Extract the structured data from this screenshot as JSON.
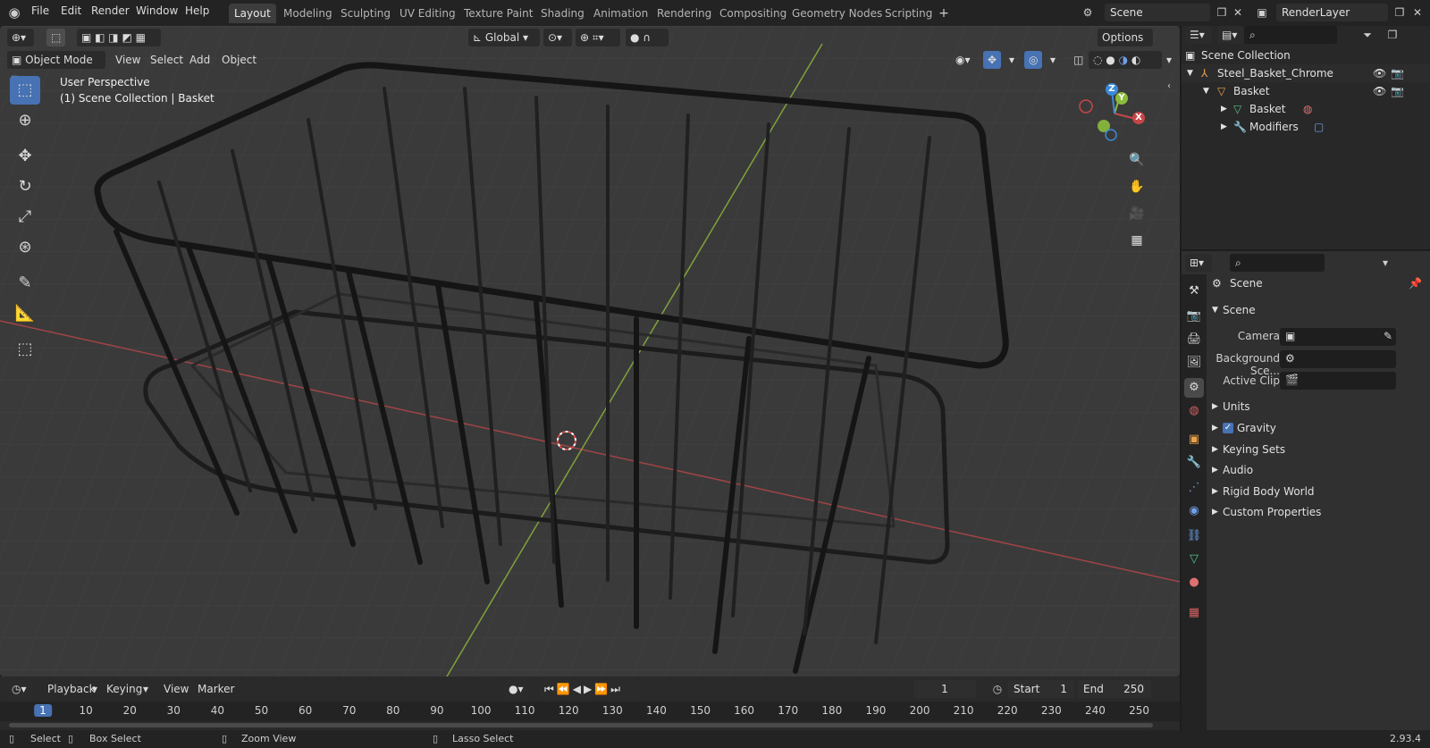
{
  "menu": [
    "File",
    "Edit",
    "Render",
    "Window",
    "Help"
  ],
  "workspaces": [
    "Layout",
    "Modeling",
    "Sculpting",
    "UV Editing",
    "Texture Paint",
    "Shading",
    "Animation",
    "Rendering",
    "Compositing",
    "Geometry Nodes",
    "Scripting"
  ],
  "scene_field": "Scene",
  "renderlayer_field": "RenderLayer",
  "viewport": {
    "transform_orientation": "Global",
    "options_label": "Options",
    "mode": "Object Mode",
    "header_menus": [
      "View",
      "Select",
      "Add",
      "Object"
    ],
    "overlay_line1": "User Perspective",
    "overlay_line2": "(1) Scene Collection | Basket",
    "gizmo": {
      "x": "X",
      "y": "Y",
      "z": "Z"
    }
  },
  "outliner": {
    "root": "Scene Collection",
    "items": [
      {
        "label": "Steel_Basket_Chrome"
      },
      {
        "label": "Basket"
      },
      {
        "label": "Basket"
      },
      {
        "label": "Modifiers"
      }
    ]
  },
  "properties": {
    "header": "Scene",
    "panel_title": "Scene",
    "fields": [
      {
        "label": "Camera"
      },
      {
        "label": "Background Sce..."
      },
      {
        "label": "Active Clip"
      }
    ],
    "subpanels": [
      "Units",
      "Gravity",
      "Keying Sets",
      "Audio",
      "Rigid Body World",
      "Custom Properties"
    ]
  },
  "timeline": {
    "menus": [
      "Playback",
      "Keying",
      "View",
      "Marker"
    ],
    "current_frame": "1",
    "start_label": "Start",
    "start_value": "1",
    "end_label": "End",
    "end_value": "250",
    "ruler": [
      "1",
      "10",
      "20",
      "30",
      "40",
      "50",
      "60",
      "70",
      "80",
      "90",
      "100",
      "110",
      "120",
      "130",
      "140",
      "150",
      "160",
      "170",
      "180",
      "190",
      "200",
      "210",
      "220",
      "230",
      "240",
      "250"
    ]
  },
  "status": {
    "select": "Select",
    "box_select": "Box Select",
    "zoom_view": "Zoom View",
    "lasso_select": "Lasso Select",
    "version": "2.93.4"
  },
  "colors": {
    "accent": "#4772b3",
    "x_axis": "#c84648",
    "y_axis": "#8cbc3c",
    "z_axis": "#3b8ad8"
  }
}
